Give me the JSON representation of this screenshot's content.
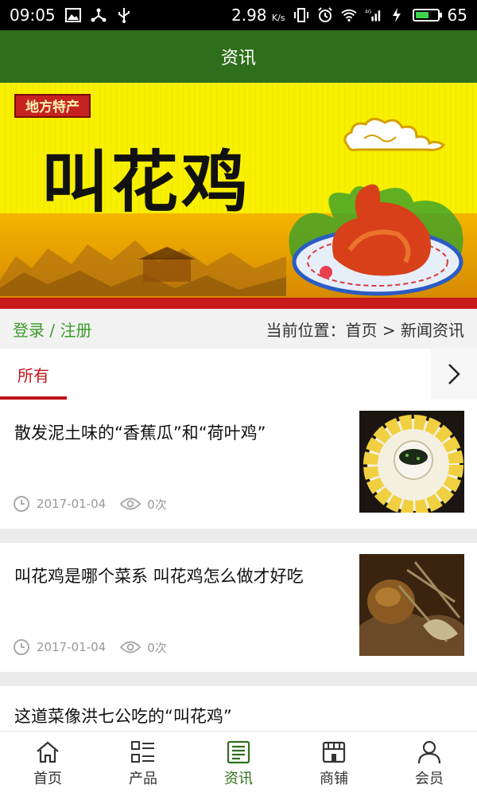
{
  "status_bar": {
    "time": "09:05",
    "speed": "2.98",
    "speed_unit": "K/s",
    "network": "4G",
    "battery": "65",
    "battery_level": 0.65
  },
  "header": {
    "title": "资讯"
  },
  "banner": {
    "tag": "地方特产",
    "title": "叫花鸡"
  },
  "breadcrumb": {
    "login": "登录 / 注册",
    "location": "当前位置：首页 > 新闻资讯"
  },
  "tabs": [
    {
      "label": "所有"
    }
  ],
  "news": [
    {
      "title": "散发泥土味的“香蕉瓜”和“荷叶鸡”",
      "date": "2017-01-04",
      "views": "0次",
      "thumb": "sliced-melon-with-dip"
    },
    {
      "title": "叫花鸡是哪个菜系 叫花鸡怎么做才好吃",
      "date": "2017-01-04",
      "views": "0次",
      "thumb": "beggars-chicken-in-lotus-leaf"
    },
    {
      "title": "这道菜像洪七公吃的“叫花鸡”"
    }
  ],
  "bottom_nav": [
    {
      "label": "首页",
      "icon": "home-icon"
    },
    {
      "label": "产品",
      "icon": "grid-list-icon"
    },
    {
      "label": "资讯",
      "icon": "news-icon",
      "active": true
    },
    {
      "label": "商铺",
      "icon": "store-icon"
    },
    {
      "label": "会员",
      "icon": "user-icon"
    }
  ],
  "colors": {
    "header_green": "#2f6f1c",
    "accent_red": "#c4131a",
    "login_green": "#3a9c2a"
  }
}
